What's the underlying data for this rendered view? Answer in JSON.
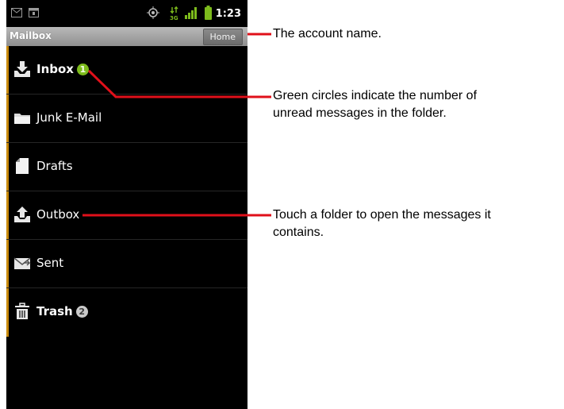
{
  "status_bar": {
    "time": "1:23",
    "icons": [
      "gmail-icon",
      "calendar-icon",
      "gps-icon",
      "network-3g-icon",
      "signal-icon",
      "battery-icon"
    ]
  },
  "title_bar": {
    "title": "Mailbox",
    "account_button": "Home"
  },
  "folders": [
    {
      "label": "Inbox",
      "icon": "download-tray-icon",
      "count": "1",
      "bold": true,
      "badge_color": "#7dbb1c"
    },
    {
      "label": "Junk E-Mail",
      "icon": "folder-icon",
      "count": "",
      "bold": false
    },
    {
      "label": "Drafts",
      "icon": "draft-page-icon",
      "count": "",
      "bold": false
    },
    {
      "label": "Outbox",
      "icon": "upload-tray-icon",
      "count": "",
      "bold": false
    },
    {
      "label": "Sent",
      "icon": "envelope-icon",
      "count": "",
      "bold": false
    },
    {
      "label": "Trash",
      "icon": "trash-icon",
      "count": "2",
      "bold": true,
      "badge_color": "#c9c9c9"
    }
  ],
  "callouts": {
    "account": "The account name.",
    "unread_line1": "Green circles indicate the number of",
    "unread_line2": "unread messages in the folder.",
    "open_line1": "Touch a folder to open the messages it",
    "open_line2": "contains."
  },
  "colors": {
    "accent_strip": "#c98a0c",
    "callout_line": "#e0101a",
    "unread_badge": "#7dbb1c"
  }
}
